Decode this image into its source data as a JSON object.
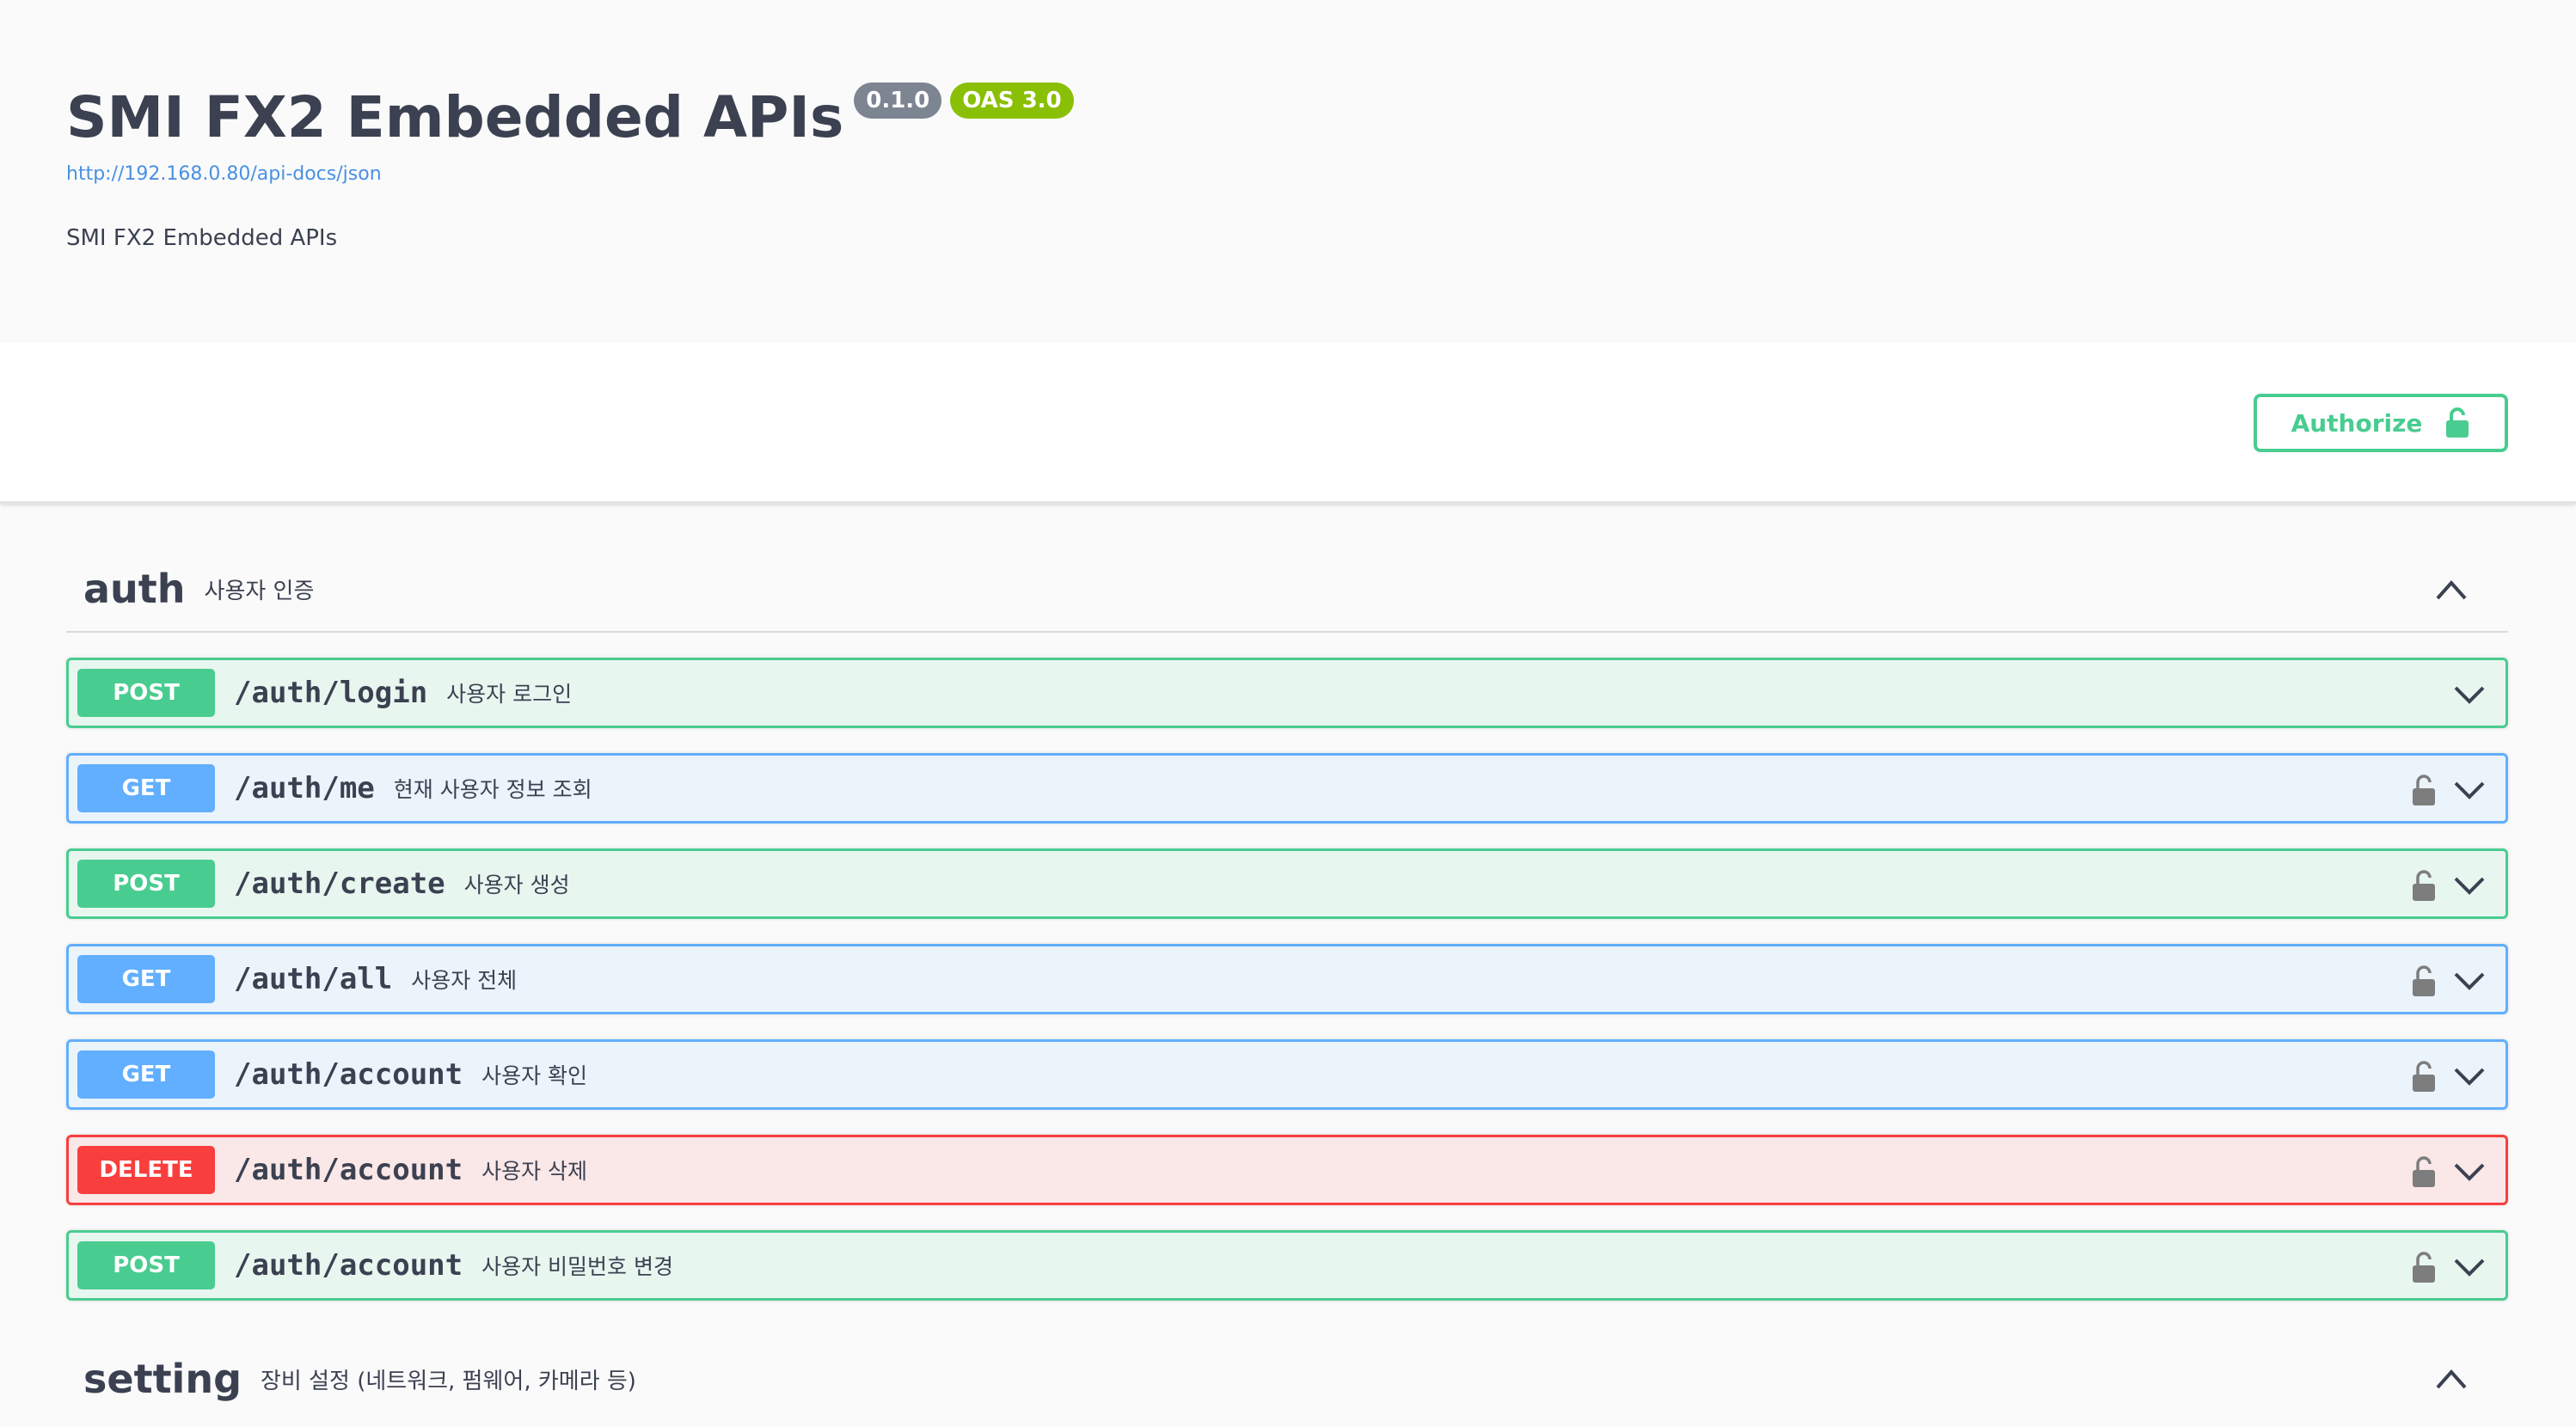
{
  "info": {
    "title": "SMI FX2 Embedded APIs",
    "version": "0.1.0",
    "oas": "OAS 3.0",
    "url": "http://192.168.0.80/api-docs/json",
    "description": "SMI FX2 Embedded APIs"
  },
  "authorize": {
    "label": "Authorize",
    "icon": "unlock-icon"
  },
  "colors": {
    "post": "#49cc90",
    "get": "#61affe",
    "delete": "#f93e3e"
  },
  "tags": [
    {
      "name": "auth",
      "description": "사용자 인증",
      "expanded": true,
      "operations": [
        {
          "method": "POST",
          "path": "/auth/login",
          "summary": "사용자 로그인",
          "locked": false
        },
        {
          "method": "GET",
          "path": "/auth/me",
          "summary": "현재 사용자 정보 조회",
          "locked": true
        },
        {
          "method": "POST",
          "path": "/auth/create",
          "summary": "사용자 생성",
          "locked": true
        },
        {
          "method": "GET",
          "path": "/auth/all",
          "summary": "사용자 전체",
          "locked": true
        },
        {
          "method": "GET",
          "path": "/auth/account",
          "summary": "사용자 확인",
          "locked": true
        },
        {
          "method": "DELETE",
          "path": "/auth/account",
          "summary": "사용자 삭제",
          "locked": true
        },
        {
          "method": "POST",
          "path": "/auth/account",
          "summary": "사용자 비밀번호 변경",
          "locked": true
        }
      ]
    },
    {
      "name": "setting",
      "description": "장비 설정 (네트워크, 펌웨어, 카메라 등)",
      "expanded": true,
      "operations": []
    }
  ]
}
